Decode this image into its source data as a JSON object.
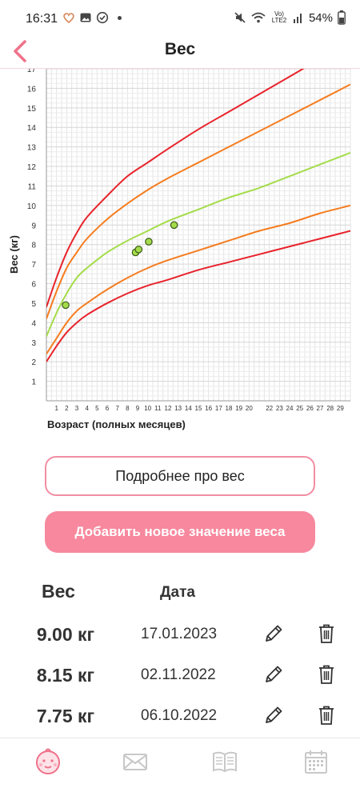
{
  "status_bar": {
    "time": "16:31",
    "network_label": "Vo) LTE2",
    "battery": "54%",
    "icons": [
      "heart-icon",
      "image-icon",
      "check-circle-icon",
      "mute-icon",
      "wifi-icon",
      "signal-icon",
      "battery-icon"
    ]
  },
  "header": {
    "title": "Вес",
    "back_icon": "chevron-left-icon",
    "accent": "#f0718a"
  },
  "chart_data": {
    "type": "line",
    "title": "",
    "ylabel": "Вес (кг)",
    "xlabel": "Возраст (полных месяцев)",
    "xlim": [
      0,
      30
    ],
    "ylim": [
      0,
      17
    ],
    "y_ticks": [
      1,
      2,
      3,
      4,
      5,
      6,
      7,
      8,
      9,
      10,
      11,
      12,
      13,
      14,
      15,
      16,
      17
    ],
    "x_ticks": [
      1,
      2,
      3,
      4,
      5,
      6,
      7,
      8,
      9,
      10,
      11,
      12,
      13,
      14,
      15,
      16,
      17,
      18,
      19,
      20,
      22,
      23,
      24,
      25,
      26,
      27,
      28,
      29
    ],
    "grid": true,
    "x": [
      0,
      1,
      2,
      3,
      4,
      6,
      8,
      10,
      12,
      15,
      18,
      21,
      24,
      27,
      30
    ],
    "series": [
      {
        "color": "#e8232b",
        "values": [
          2.0,
          2.8,
          3.5,
          4.0,
          4.4,
          5.0,
          5.5,
          5.9,
          6.2,
          6.7,
          7.1,
          7.5,
          7.9,
          8.3,
          8.7
        ]
      },
      {
        "color": "#f57c1f",
        "values": [
          2.4,
          3.2,
          4.0,
          4.6,
          5.0,
          5.7,
          6.3,
          6.8,
          7.2,
          7.7,
          8.2,
          8.7,
          9.1,
          9.6,
          10.0
        ]
      },
      {
        "color": "#a4dc4a",
        "values": [
          3.3,
          4.5,
          5.5,
          6.3,
          6.8,
          7.6,
          8.2,
          8.7,
          9.2,
          9.8,
          10.4,
          10.9,
          11.5,
          12.1,
          12.7
        ]
      },
      {
        "color": "#f57c1f",
        "values": [
          4.2,
          5.6,
          6.8,
          7.6,
          8.3,
          9.3,
          10.1,
          10.8,
          11.4,
          12.2,
          13.0,
          13.8,
          14.6,
          15.4,
          16.2
        ]
      },
      {
        "color": "#e8232b",
        "values": [
          4.8,
          6.3,
          7.6,
          8.6,
          9.4,
          10.5,
          11.5,
          12.2,
          12.9,
          13.9,
          14.8,
          15.7,
          16.6,
          17.5,
          18.3
        ]
      }
    ],
    "points": [
      {
        "x": 1.9,
        "y": 4.9
      },
      {
        "x": 8.8,
        "y": 7.6
      },
      {
        "x": 9.1,
        "y": 7.75
      },
      {
        "x": 10.1,
        "y": 8.15
      },
      {
        "x": 12.6,
        "y": 9.0
      }
    ]
  },
  "buttons": {
    "more_label": "Подробнее про вес",
    "add_label": "Добавить новое значение веса"
  },
  "table": {
    "col_weight": "Вес",
    "col_date": "Дата",
    "rows": [
      {
        "weight": "9.00 кг",
        "date": "17.01.2023"
      },
      {
        "weight": "8.15 кг",
        "date": "02.11.2022"
      },
      {
        "weight": "7.75 кг",
        "date": "06.10.2022"
      }
    ]
  },
  "bottom_nav": {
    "items": [
      "baby-face-icon",
      "mail-icon",
      "book-icon",
      "calendar-icon"
    ]
  }
}
